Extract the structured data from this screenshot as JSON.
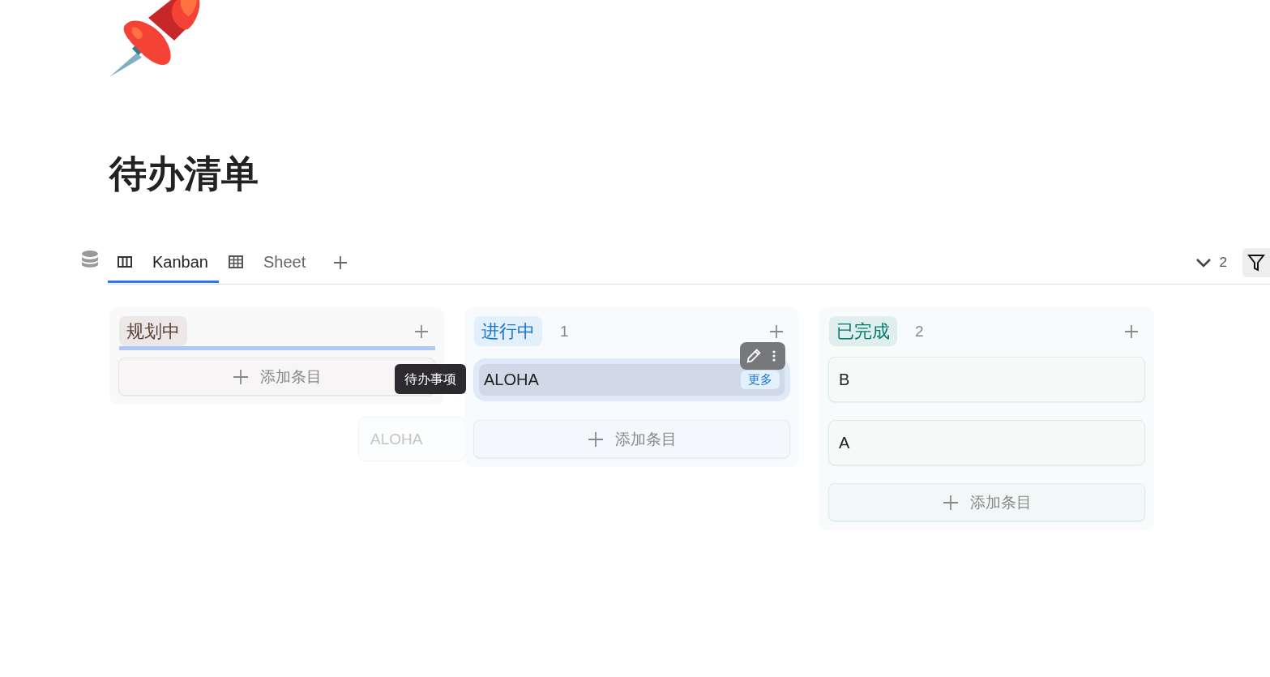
{
  "page": {
    "title": "待办清单"
  },
  "toolbar": {
    "tabs": [
      {
        "label": "Kanban",
        "kind": "board",
        "selected": true
      },
      {
        "label": "Sheet",
        "kind": "grid",
        "selected": false
      }
    ],
    "hidden_count": "2"
  },
  "columns": [
    {
      "label": "规划中",
      "color": "#5d4037",
      "drop_target": true,
      "add_label": "添加条目"
    },
    {
      "label": "进行中",
      "color": "#1976d2",
      "count": "1",
      "drop_target": false,
      "add_label": "添加条目",
      "cards": [
        {
          "title": "ALOHA",
          "hovered": true,
          "badge": "更多"
        }
      ]
    },
    {
      "label": "已完成",
      "color": "#00796b",
      "count": "2",
      "drop_target": false,
      "add_label": "添加条目",
      "cards": [
        {
          "title": "B",
          "hovered": false
        },
        {
          "title": "A",
          "hovered": false
        }
      ]
    }
  ],
  "tooltip": {
    "text": "待办事项"
  },
  "drag_ghost": {
    "title": "ALOHA"
  }
}
